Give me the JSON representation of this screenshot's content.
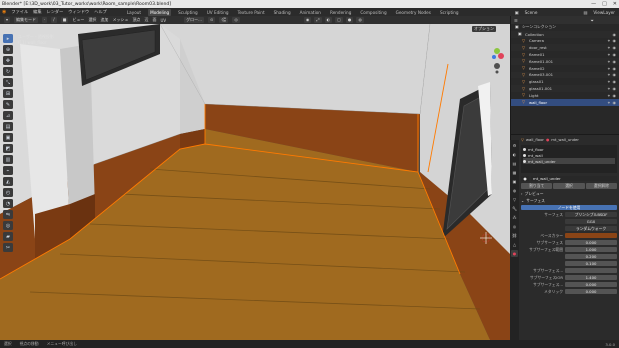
{
  "title_bar": {
    "title": "Blender* [E:\\3D_work\\03_Tutor_works\\work\\Room_sample\\Room03.blend]",
    "min": "—",
    "max": "□",
    "close": "✕"
  },
  "menu": {
    "items": [
      "ファイル",
      "編集",
      "レンダー",
      "ウィンドウ",
      "ヘルプ"
    ],
    "workspaces": [
      "Layout",
      "Modeling",
      "Sculpting",
      "UV Editing",
      "Texture Paint",
      "Shading",
      "Animation",
      "Rendering",
      "Compositing",
      "Geometry Nodes",
      "Scripting"
    ],
    "active_workspace": "Modeling",
    "scene": "Scene",
    "view_layer": "ViewLayer"
  },
  "viewport_header": {
    "mode": "編集モード",
    "items": [
      "ビュー",
      "選択",
      "追加",
      "メッシュ",
      "頂点",
      "辺",
      "面",
      "UV"
    ],
    "transform": "グロー...",
    "options": "オプション"
  },
  "viewport_overlay": {
    "view_name": "ユーザー・透視投影",
    "object_info": "(11) wall_floor"
  },
  "gizmo": {
    "axis_y": "Y",
    "axis_x": "X",
    "axis_z": "Z"
  },
  "toolbar_icons": [
    "select-box-icon",
    "cursor-icon",
    "move-icon",
    "rotate-icon",
    "scale-icon",
    "transform-icon",
    "annotate-icon",
    "measure-icon",
    "extrude-icon",
    "inset-icon",
    "bevel-icon",
    "loopcut-icon",
    "knife-icon",
    "polybuild-icon",
    "spin-icon",
    "smooth-icon",
    "edge-slide-icon",
    "shrink-icon",
    "shear-icon",
    "rip-icon"
  ],
  "outliner": {
    "title": "シーンコレクション",
    "collection": "Collection",
    "items": [
      {
        "name": "Camera",
        "selected": false
      },
      {
        "name": "door_rest",
        "selected": false
      },
      {
        "name": "flame01",
        "selected": false
      },
      {
        "name": "flame01.001",
        "selected": false
      },
      {
        "name": "flame02",
        "selected": false
      },
      {
        "name": "flame03.001",
        "selected": false
      },
      {
        "name": "glass01",
        "selected": false
      },
      {
        "name": "glass01.001",
        "selected": false
      },
      {
        "name": "Light",
        "selected": false
      },
      {
        "name": "wall_floor",
        "selected": true
      }
    ]
  },
  "properties": {
    "object_name": "wall_floor",
    "slots": [
      "mt_floor",
      "mt_wall",
      "mt_wall_under"
    ],
    "selected_slot": "mt_wall_under",
    "slot_buttons": [
      "割り当て",
      "選択",
      "選択解除"
    ],
    "material_name": "mt_wall_under",
    "sections": {
      "preview": "プレビュー",
      "surface": "サーフェス"
    },
    "use_nodes": "ノードを使用",
    "surface_label": "サーフェス",
    "surface_value": "プリンシプルBSDF",
    "distribution": "GGX",
    "subsurface_method": "ランダムウォーク",
    "rows": [
      {
        "label": "ベースカラー",
        "value": ""
      },
      {
        "label": "サブサーフェス",
        "value": "0.000"
      },
      {
        "label": "サブサーフェス範囲",
        "value": "1.000"
      },
      {
        "label": "",
        "value": "0.200"
      },
      {
        "label": "",
        "value": "0.100"
      },
      {
        "label": "サブサーフェス...",
        "value": ""
      },
      {
        "label": "サブサーフェスIOR",
        "value": "1.400"
      },
      {
        "label": "サブサーフェス...",
        "value": "0.000"
      },
      {
        "label": "メタリック",
        "value": "0.000"
      }
    ],
    "tab_icons": [
      "tool-icon",
      "render-icon",
      "output-icon",
      "view-layer-icon",
      "scene-icon",
      "world-icon",
      "object-icon",
      "modifier-icon",
      "particles-icon",
      "physics-icon",
      "constraints-icon",
      "data-icon",
      "material-icon"
    ]
  },
  "status_bar": {
    "left": [
      "選択",
      "視点の移動",
      "メニュー呼び出し"
    ],
    "right": "3.0.0"
  },
  "colors": {
    "floor": "#a06a1f",
    "wall_under": "#8a4416",
    "wall": "#d9d9d9",
    "accent": "#4772b3"
  }
}
